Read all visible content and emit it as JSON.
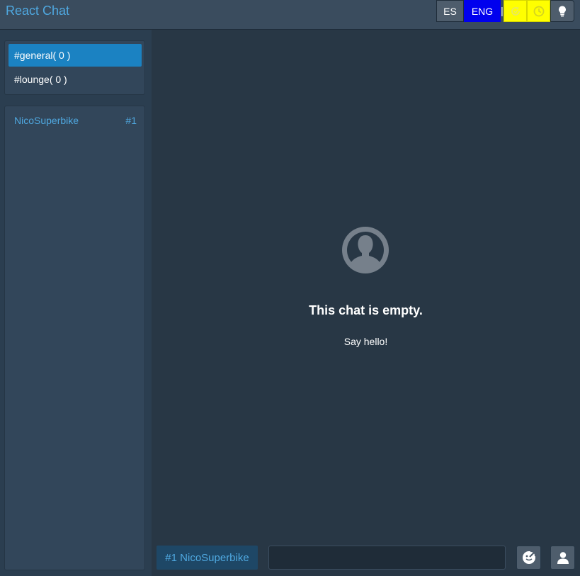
{
  "app": {
    "title": "React Chat"
  },
  "toolbar": {
    "lang_es": "ES",
    "lang_eng": "ENG",
    "separator": "|",
    "icons": [
      "refresh-icon",
      "clock-icon",
      "lightbulb-icon"
    ],
    "active_lang_color": "#0000ee",
    "highlight_color": "#ffff00"
  },
  "channels": [
    {
      "label": "#general( 0 )",
      "active": true
    },
    {
      "label": "#lounge( 0 )",
      "active": false
    }
  ],
  "users": [
    {
      "name": "NicoSuperbike",
      "number": "#1"
    }
  ],
  "chat": {
    "empty_title": "This chat is empty.",
    "empty_subtitle": "Say hello!"
  },
  "composer": {
    "user_badge": "#1 NicoSuperbike",
    "input_value": "",
    "input_placeholder": ""
  },
  "colors": {
    "accent": "#1b82c2",
    "link": "#4fa8e0",
    "background": "#2b3e50"
  }
}
